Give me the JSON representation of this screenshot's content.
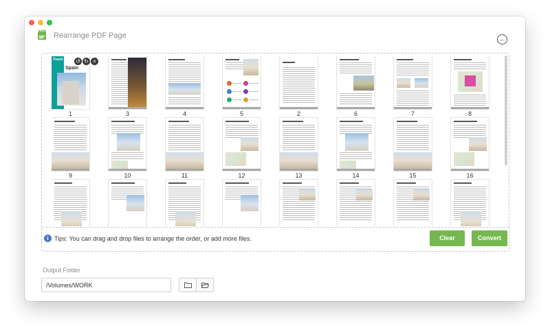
{
  "window": {
    "title": "Rearrange PDF Page",
    "back_icon": "arrow-left-circle-icon",
    "app_logo_icon": "pdf-logo-icon",
    "brand_green": "#76b751"
  },
  "pages": [
    {
      "label": "1",
      "kind": "cover"
    },
    {
      "label": "3",
      "kind": "text-photo"
    },
    {
      "label": "4",
      "kind": "text-landscape"
    },
    {
      "label": "5",
      "kind": "icons"
    },
    {
      "label": "2",
      "kind": "index"
    },
    {
      "label": "6",
      "kind": "text-road"
    },
    {
      "label": "7",
      "kind": "text-small-pics"
    },
    {
      "label": "8",
      "kind": "map"
    },
    {
      "label": "9",
      "kind": "text-bottom-photo"
    },
    {
      "label": "10",
      "kind": "tour-photo"
    },
    {
      "label": "11",
      "kind": "text-bottom-photo"
    },
    {
      "label": "12",
      "kind": "tour-map"
    },
    {
      "label": "13",
      "kind": "text-bottom-photo"
    },
    {
      "label": "14",
      "kind": "tour-photo"
    },
    {
      "label": "15",
      "kind": "text-bottom-photo"
    },
    {
      "label": "16",
      "kind": "tour-map"
    },
    {
      "label": "",
      "kind": "text-partial"
    },
    {
      "label": "",
      "kind": "tour-partial"
    },
    {
      "label": "",
      "kind": "text-partial"
    },
    {
      "label": "",
      "kind": "tour-partial"
    },
    {
      "label": "",
      "kind": "list-partial"
    },
    {
      "label": "",
      "kind": "list-partial"
    },
    {
      "label": "",
      "kind": "list-partial"
    },
    {
      "label": "",
      "kind": "text-partial"
    }
  ],
  "first_page_controls": [
    "rotate-left-icon",
    "rotate-right-icon",
    "close-icon"
  ],
  "tips": {
    "icon": "info-icon",
    "text": "Tips: You can drag and drop files to arrange the order, or add more files."
  },
  "buttons": {
    "clear": "Clear",
    "convert": "Convert"
  },
  "output": {
    "label": "Output Folder",
    "value": "/Volumes/WORK",
    "folder_icon": "folder-icon",
    "open_folder_icon": "open-folder-icon"
  }
}
